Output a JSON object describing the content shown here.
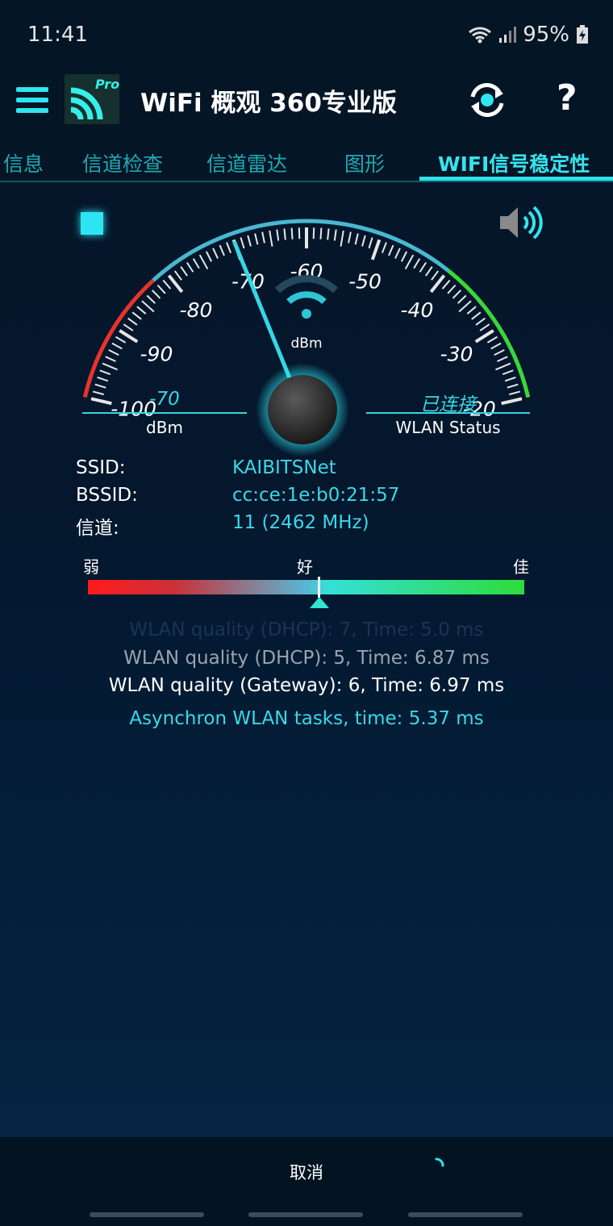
{
  "status": {
    "time": "11:41",
    "battery": "95%"
  },
  "app": {
    "title": "WiFi 概观 360专业版",
    "logo_badge": "Pro"
  },
  "tabs": [
    {
      "label": "信息"
    },
    {
      "label": "信道检查"
    },
    {
      "label": "信道雷达"
    },
    {
      "label": "图形"
    },
    {
      "label": "WIFI信号稳定性",
      "active": true
    }
  ],
  "gauge": {
    "unit": "dBm",
    "value": -70,
    "min": -100,
    "max": -20,
    "tick_labels": [
      "-100",
      "-90",
      "-80",
      "-70",
      "-60",
      "-50",
      "-40",
      "-30",
      "-20"
    ]
  },
  "readouts": {
    "left_value": "-70",
    "left_label": "dBm",
    "right_value": "已连接",
    "right_label": "WLAN Status"
  },
  "info": {
    "ssid_label": "SSID:",
    "ssid_value": "KAIBITSNet",
    "bssid_label": "BSSID:",
    "bssid_value": "cc:ce:1e:b0:21:57",
    "channel_label": "信道:",
    "channel_value": "11 (2462 MHz)"
  },
  "quality": {
    "weak": "弱",
    "good": "好",
    "best": "佳"
  },
  "log": {
    "faded": "WLAN quality (DHCP): 7, Time: 5.0 ms",
    "dhcp": "WLAN quality (DHCP): 5, Time: 6.87 ms",
    "gateway": "WLAN quality (Gateway): 6, Time: 6.97 ms",
    "async": "Asynchron WLAN tasks, time: 5.37 ms"
  },
  "bottom": {
    "cancel_label": "取消"
  },
  "colors": {
    "accent": "#2ee6f0",
    "background": "#04172d"
  }
}
